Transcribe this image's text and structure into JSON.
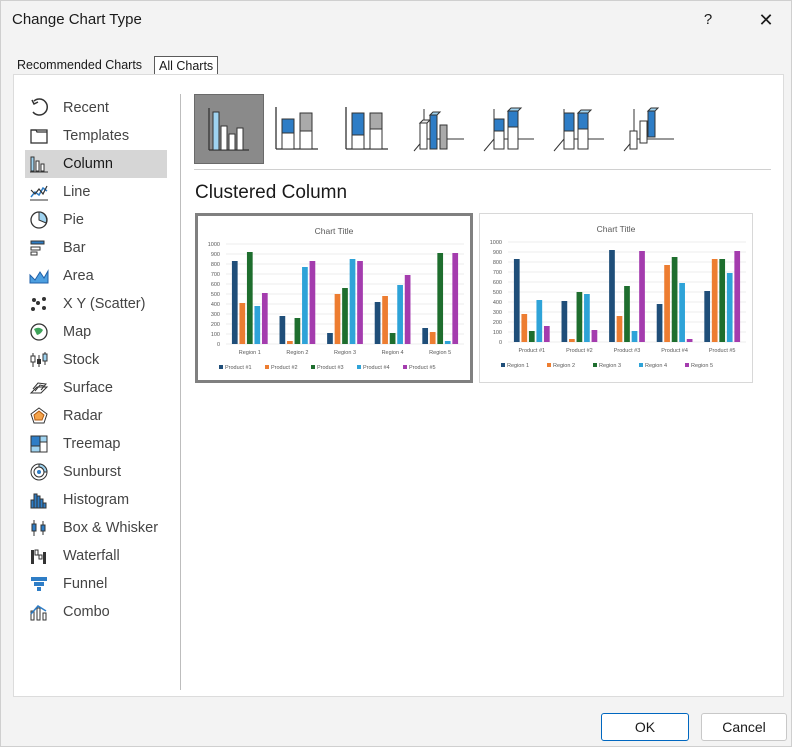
{
  "dialog": {
    "title": "Change Chart Type",
    "help_label": "?",
    "close_label": "✕"
  },
  "tabs": [
    {
      "label": "Recommended Charts",
      "selected": false
    },
    {
      "label": "All Charts",
      "selected": true
    }
  ],
  "chart_types": [
    {
      "label": "Recent",
      "icon": "recent-icon"
    },
    {
      "label": "Templates",
      "icon": "templates-icon"
    },
    {
      "label": "Column",
      "icon": "column-chart-icon",
      "selected": true
    },
    {
      "label": "Line",
      "icon": "line-chart-icon"
    },
    {
      "label": "Pie",
      "icon": "pie-chart-icon"
    },
    {
      "label": "Bar",
      "icon": "bar-chart-icon"
    },
    {
      "label": "Area",
      "icon": "area-chart-icon"
    },
    {
      "label": "X Y (Scatter)",
      "icon": "scatter-chart-icon"
    },
    {
      "label": "Map",
      "icon": "map-chart-icon"
    },
    {
      "label": "Stock",
      "icon": "stock-chart-icon"
    },
    {
      "label": "Surface",
      "icon": "surface-chart-icon"
    },
    {
      "label": "Radar",
      "icon": "radar-chart-icon"
    },
    {
      "label": "Treemap",
      "icon": "treemap-chart-icon"
    },
    {
      "label": "Sunburst",
      "icon": "sunburst-chart-icon"
    },
    {
      "label": "Histogram",
      "icon": "histogram-chart-icon"
    },
    {
      "label": "Box & Whisker",
      "icon": "box-whisker-chart-icon"
    },
    {
      "label": "Waterfall",
      "icon": "waterfall-chart-icon"
    },
    {
      "label": "Funnel",
      "icon": "funnel-chart-icon"
    },
    {
      "label": "Combo",
      "icon": "combo-chart-icon"
    }
  ],
  "subtypes": [
    {
      "icon": "clustered-column-icon",
      "selected": true
    },
    {
      "icon": "stacked-column-icon"
    },
    {
      "icon": "100-stacked-column-icon"
    },
    {
      "icon": "3d-clustered-column-icon"
    },
    {
      "icon": "3d-stacked-column-icon"
    },
    {
      "icon": "3d-100-stacked-column-icon"
    },
    {
      "icon": "3d-column-icon"
    }
  ],
  "subtype_title": "Clustered Column",
  "colors": {
    "series": [
      "#1f4e79",
      "#ed7d31",
      "#1e6e2e",
      "#2ea3d8",
      "#a43cae"
    ]
  },
  "chart_data": [
    {
      "type": "bar",
      "title": "Chart Title",
      "categories": [
        "Region 1",
        "Region 2",
        "Region 3",
        "Region 4",
        "Region 5"
      ],
      "ylim": [
        0,
        1000
      ],
      "yticks": [
        "0",
        "100",
        "200",
        "300",
        "400",
        "500",
        "600",
        "700",
        "800",
        "900",
        "1000"
      ],
      "legend_position": "bottom",
      "series": [
        {
          "name": "Product #1",
          "values": [
            830,
            280,
            110,
            420,
            160
          ]
        },
        {
          "name": "Product #2",
          "values": [
            410,
            30,
            500,
            480,
            120
          ]
        },
        {
          "name": "Product #3",
          "values": [
            920,
            260,
            560,
            110,
            910
          ]
        },
        {
          "name": "Product #4",
          "values": [
            380,
            770,
            850,
            590,
            30
          ]
        },
        {
          "name": "Product #5",
          "values": [
            510,
            830,
            830,
            690,
            910
          ]
        }
      ]
    },
    {
      "type": "bar",
      "title": "Chart Title",
      "categories": [
        "Product #1",
        "Product #2",
        "Product #3",
        "Product #4",
        "Product #5"
      ],
      "ylim": [
        0,
        1000
      ],
      "yticks": [
        "0",
        "100",
        "200",
        "300",
        "400",
        "500",
        "600",
        "700",
        "800",
        "900",
        "1000"
      ],
      "legend_position": "bottom",
      "series": [
        {
          "name": "Region 1",
          "values": [
            830,
            410,
            920,
            380,
            510
          ]
        },
        {
          "name": "Region 2",
          "values": [
            280,
            30,
            260,
            770,
            830
          ]
        },
        {
          "name": "Region 3",
          "values": [
            110,
            500,
            560,
            850,
            830
          ]
        },
        {
          "name": "Region 4",
          "values": [
            420,
            480,
            110,
            590,
            690
          ]
        },
        {
          "name": "Region 5",
          "values": [
            160,
            120,
            910,
            30,
            910
          ]
        }
      ]
    }
  ],
  "buttons": {
    "ok": "OK",
    "cancel": "Cancel"
  }
}
